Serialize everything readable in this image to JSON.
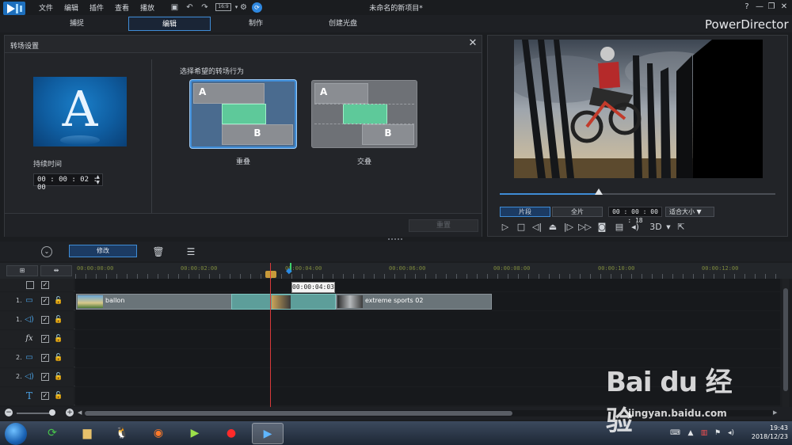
{
  "app": {
    "window_title": "未命名的新项目*",
    "brand": "PowerDirector",
    "menu": [
      "文件",
      "编辑",
      "插件",
      "查看",
      "播放"
    ],
    "quick_actions": [
      "save-icon",
      "undo-icon",
      "redo-icon",
      "aspect-ratio-icon",
      "settings-icon",
      "update-icon"
    ],
    "aspect_ratio": "16:9",
    "window_buttons": [
      "?",
      "—",
      "❐",
      "✕"
    ]
  },
  "mode_tabs": [
    {
      "label": "捕捉",
      "active": false
    },
    {
      "label": "编辑",
      "active": true
    },
    {
      "label": "制作",
      "active": false
    },
    {
      "label": "创建光盘",
      "active": false
    }
  ],
  "transition_settings": {
    "title": "转场设置",
    "thumbnail_letter": "A",
    "duration_label": "持续时间",
    "duration_value": "00 : 00 : 02 : 00",
    "behavior_label": "选择希望的转场行为",
    "options": [
      {
        "label": "重叠",
        "selected": true,
        "clip_a": "A",
        "clip_b": "B"
      },
      {
        "label": "交叠",
        "selected": false,
        "clip_a": "A",
        "clip_b": "B"
      }
    ],
    "reset_label": "重置"
  },
  "preview": {
    "tab_clip": "片段",
    "tab_movie": "全片",
    "timecode": "00 : 00 : 00 : 18",
    "fit_label": "适合大小",
    "controls": [
      "play-icon",
      "stop-icon",
      "prev-frame-icon",
      "mark-icon",
      "next-frame-icon",
      "fast-forward-icon",
      "snapshot-icon",
      "subtitle-icon",
      "volume-icon",
      "3d-icon",
      "undock-icon"
    ],
    "mode_3d": "3D",
    "scrub_progress": 0.36
  },
  "edit_toolbar": {
    "modify_label": "修改"
  },
  "timeline": {
    "ruler_ticks": [
      "00:00:00:00",
      "00:00:02:00",
      "00:00:04:00",
      "00:00:06:00",
      "00:00:08:00",
      "00:00:10:00",
      "00:00:12:00"
    ],
    "playhead_tooltip": "00:00:04:03",
    "tracks": [
      {
        "num": "",
        "icon": "master-track-icon"
      },
      {
        "num": "1.",
        "icon": "video-track-icon"
      },
      {
        "num": "1.",
        "icon": "audio-track-icon"
      },
      {
        "num": "",
        "icon": "fx-track-icon"
      },
      {
        "num": "2.",
        "icon": "video-track-icon"
      },
      {
        "num": "2.",
        "icon": "audio-track-icon"
      },
      {
        "num": "",
        "icon": "title-track-icon"
      }
    ],
    "clips": {
      "ballon": "ballon",
      "extreme": "extreme sports 02"
    }
  },
  "taskbar": {
    "time": "19:43",
    "date": "2018/12/23"
  },
  "watermark": {
    "text": "Bai du 经验",
    "url": "jingyan.baidu.com"
  }
}
